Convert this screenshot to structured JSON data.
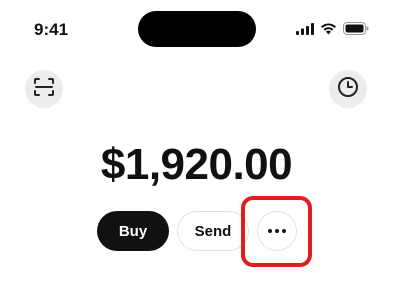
{
  "status_bar": {
    "time": "9:41",
    "icons": [
      "signal-icon",
      "wifi-icon",
      "battery-icon"
    ]
  },
  "header": {
    "left_icon": "scan-icon",
    "right_icon": "clock-icon"
  },
  "balance": {
    "amount": "$1,920.00"
  },
  "actions": {
    "buy_label": "Buy",
    "send_label": "Send",
    "more_icon": "more-horizontal-icon"
  },
  "colors": {
    "primary": "#111111",
    "background": "#ffffff",
    "highlight": "#e11d1d",
    "icon_bg": "#ececec"
  }
}
